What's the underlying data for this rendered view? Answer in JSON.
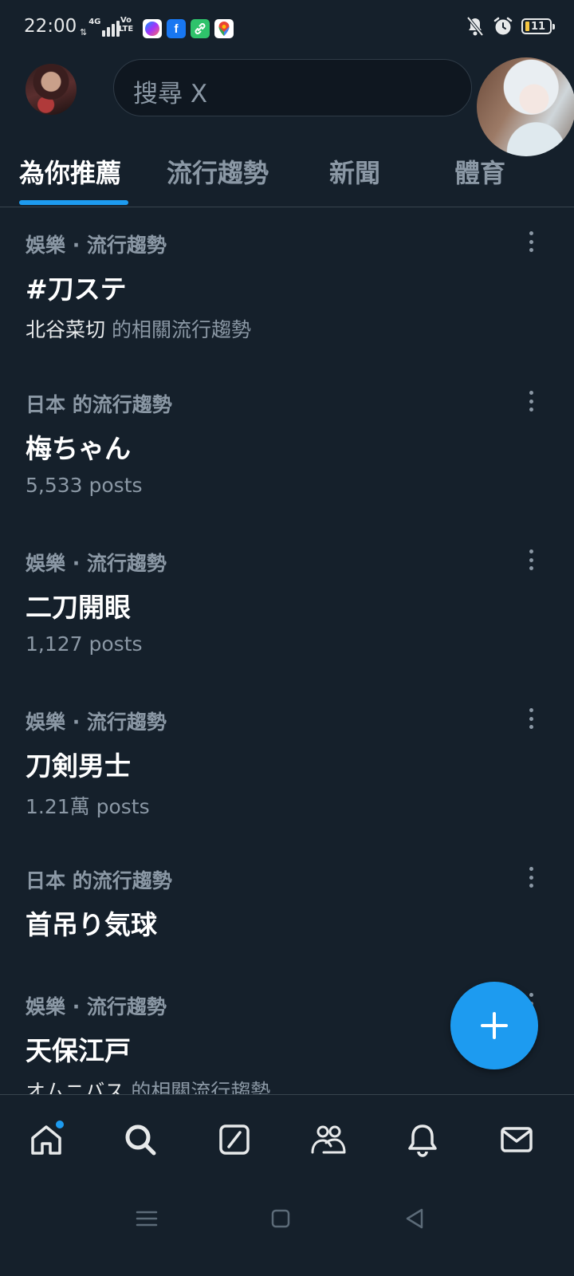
{
  "status_bar": {
    "time": "22:00",
    "network": "4G",
    "volte": "Vo\nLTE",
    "app_icons": [
      "messenger-icon",
      "facebook-icon",
      "link-icon",
      "maps-icon"
    ],
    "facebook_letter": "f",
    "battery_level": "11"
  },
  "header": {
    "search_placeholder": "搜尋 X"
  },
  "tabs": [
    {
      "label": "為你推薦",
      "active": true
    },
    {
      "label": "流行趨勢",
      "active": false
    },
    {
      "label": "新聞",
      "active": false
    },
    {
      "label": "體育",
      "active": false
    }
  ],
  "trends": [
    {
      "meta": "娛樂 · 流行趨勢",
      "title": "#刀ステ",
      "sub_highlight": "北谷菜切",
      "sub": " 的相關流行趨勢"
    },
    {
      "meta": "日本 的流行趨勢",
      "title": "梅ちゃん",
      "sub_highlight": "",
      "sub": "5,533 posts"
    },
    {
      "meta": "娛樂 · 流行趨勢",
      "title": "二刀開眼",
      "sub_highlight": "",
      "sub": "1,127 posts"
    },
    {
      "meta": "娛樂 · 流行趨勢",
      "title": "刀剣男士",
      "sub_highlight": "",
      "sub": "1.21萬 posts"
    },
    {
      "meta": "日本 的流行趨勢",
      "title": "首吊り気球",
      "sub_highlight": "",
      "sub": ""
    },
    {
      "meta": "娛樂 · 流行趨勢",
      "title": "天保江戸",
      "sub_highlight": "オムニバス",
      "sub": " 的相關流行趨勢"
    }
  ],
  "bottom_nav": [
    "home-icon",
    "search-icon",
    "grok-icon",
    "communities-icon",
    "notifications-icon",
    "messages-icon"
  ],
  "colors": {
    "background": "#15202b",
    "accent": "#1d9bf0",
    "text_primary": "#e7e9ea",
    "text_secondary": "#8b98a5",
    "divider": "#38444d"
  }
}
